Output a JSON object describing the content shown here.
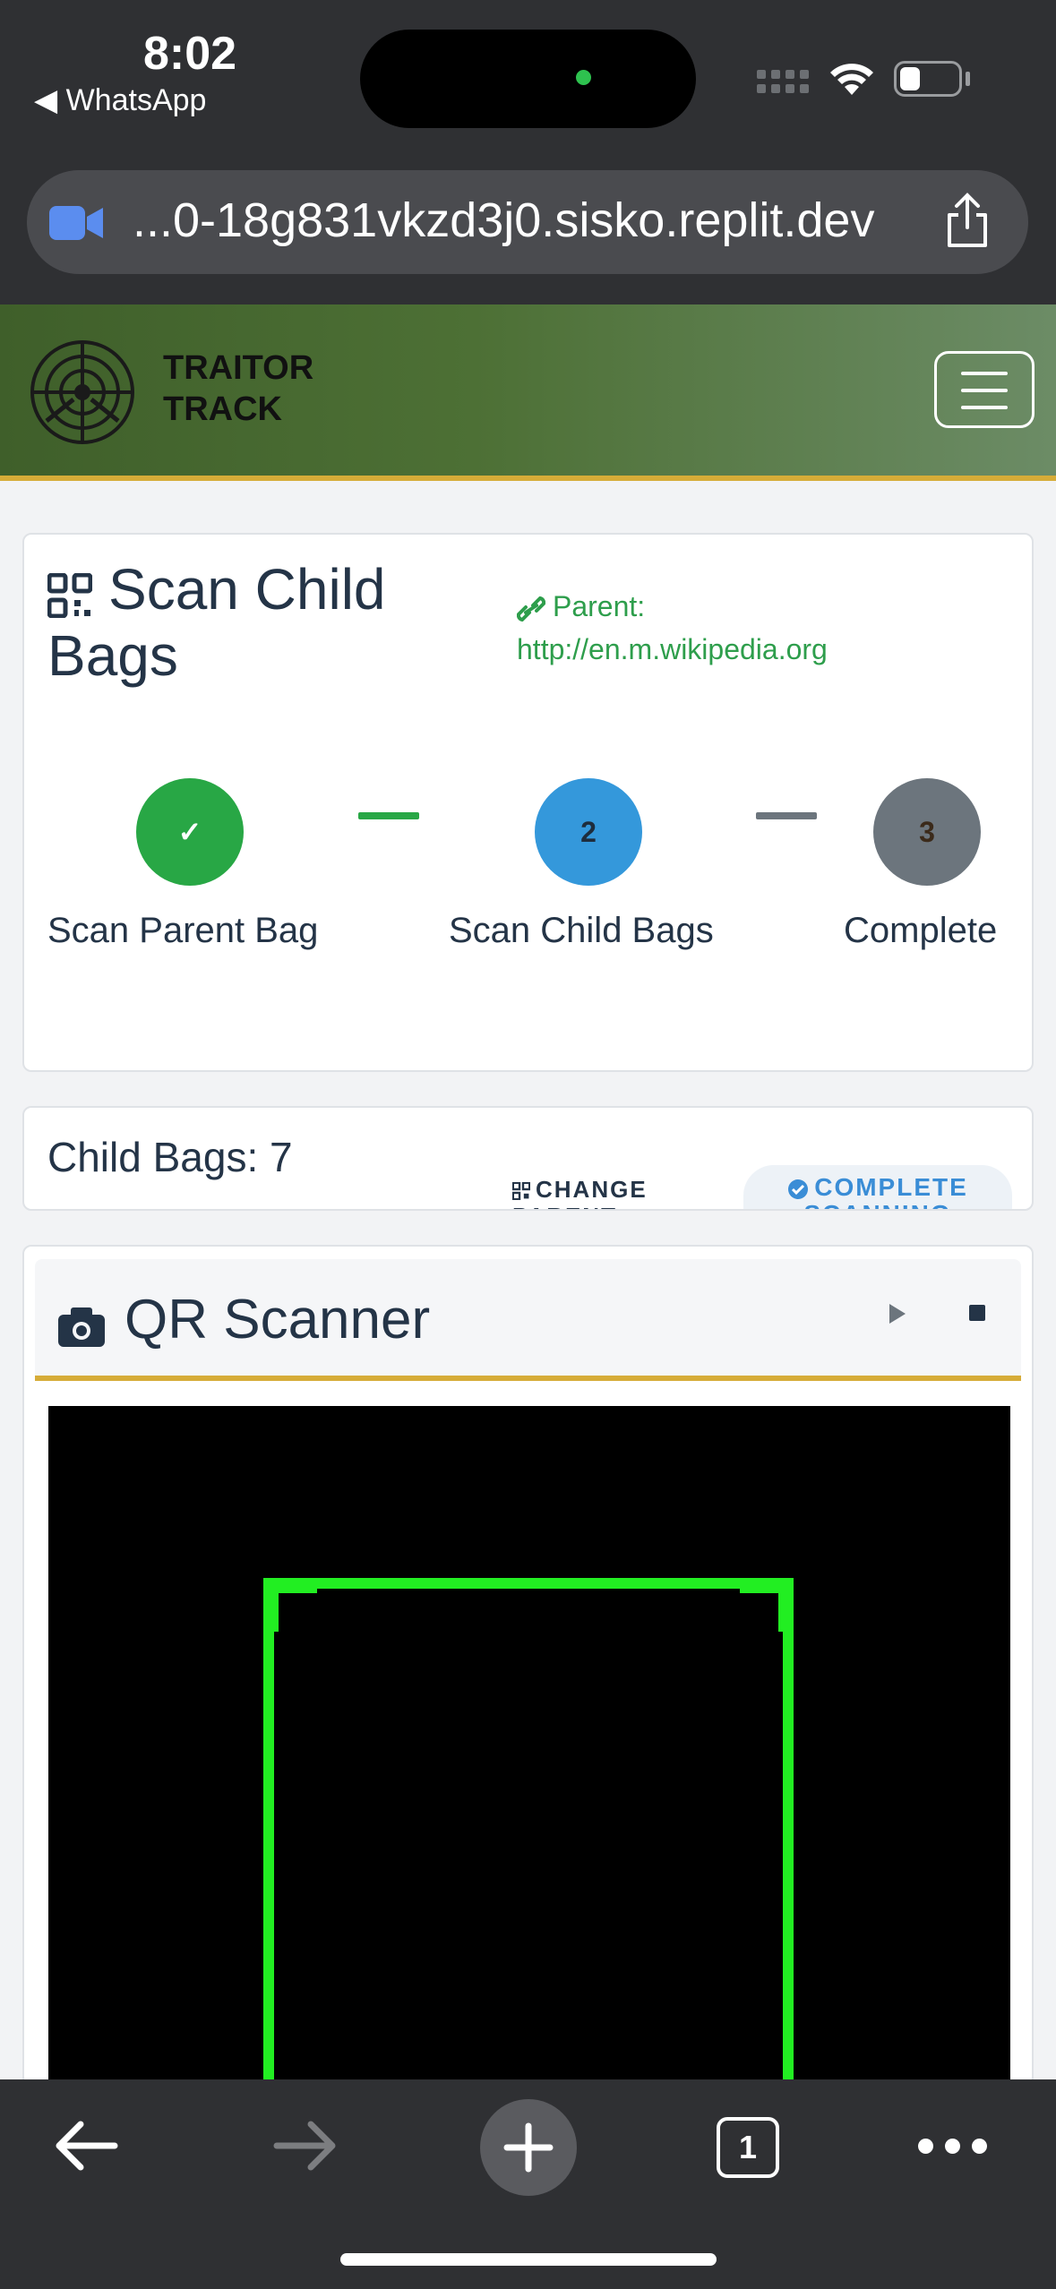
{
  "status_bar": {
    "time": "8:02",
    "back_app": "◀ WhatsApp"
  },
  "browser": {
    "url": "...0-18g831vkzd3j0.sisko.replit.dev",
    "tab_count": "1"
  },
  "header": {
    "brand_line1": "TRAITOR",
    "brand_line2": "TRACK",
    "accent_color": "#d6ac38",
    "gradient_start": "#3f5f2a"
  },
  "scan_card": {
    "title": "Scan Child Bags",
    "parent_label": "Parent:",
    "parent_value": "http://en.m.wikipedia.org",
    "steps": [
      {
        "marker": "✓",
        "label": "Scan Parent Bag",
        "state": "done",
        "color": "#28a745"
      },
      {
        "marker": "2",
        "label": "Scan Child Bags",
        "state": "active",
        "color": "#3498db"
      },
      {
        "marker": "3",
        "label": "Complete",
        "state": "pending",
        "color": "#6c757d"
      }
    ]
  },
  "child_card": {
    "count_label": "Child Bags: 7",
    "change_parent": "CHANGE PARENT",
    "complete_scanning": "COMPLETE SCANNING"
  },
  "qr_card": {
    "title": "QR Scanner",
    "frame_color": "#22ee22"
  },
  "icons": [
    "qrcode-icon",
    "link-icon",
    "camera-icon",
    "play-icon",
    "stop-icon",
    "check-circle-icon",
    "menu-icon",
    "share-icon",
    "video-icon"
  ]
}
